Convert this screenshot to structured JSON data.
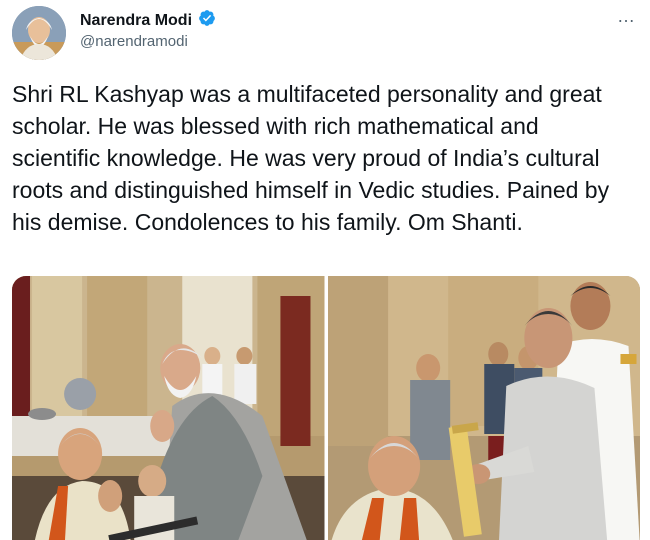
{
  "author": {
    "name": "Narendra Modi",
    "handle": "@narendramodi",
    "verified": true,
    "verified_color": "#1d9bf0"
  },
  "more_icon": "…",
  "tweet": {
    "text": "Shri RL Kashyap was a multifaceted personality and great scholar. He was blessed with rich mathematical and scientific knowledge. He was very proud of India’s cultural roots and distinguished himself in Vedic studies. Pained by his demise. Condolences to his family. Om Shanti."
  },
  "media": {
    "count": 2,
    "photos": [
      {
        "icon": "photo-pm-greeting-scholar"
      },
      {
        "icon": "photo-president-presenting-award"
      }
    ]
  }
}
